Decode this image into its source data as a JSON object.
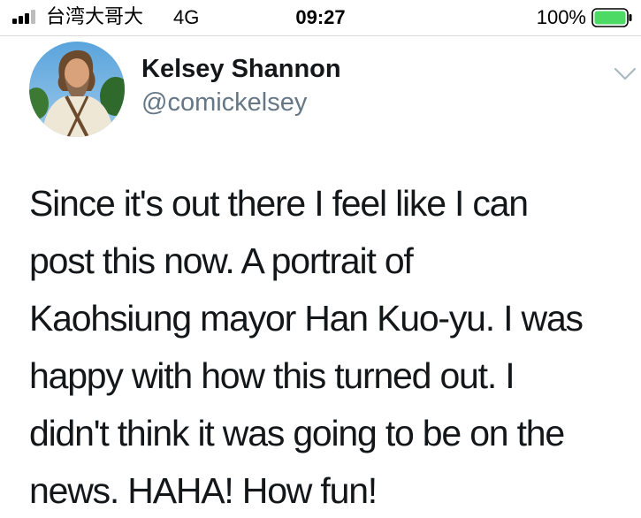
{
  "status_bar": {
    "carrier": "台湾大哥大",
    "network": "4G",
    "time": "09:27",
    "battery_percent": "100%",
    "battery_level": 1.0,
    "signal_bars_filled": 3,
    "battery_color": "#4cd964"
  },
  "tweet": {
    "display_name": "Kelsey Shannon",
    "handle": "@comickelsey",
    "text": "Since it's out there I feel like I can\npost this now. A portrait of\nKaohsiung mayor Han Kuo-yu. I was\nhappy with how this turned out. I\ndidn't think it was going to be on the\nnews. HAHA! How fun!",
    "menu_icon": "chevron-down-icon"
  },
  "colors": {
    "name": "#14171a",
    "handle": "#657786",
    "chevron": "#aab8c2"
  }
}
